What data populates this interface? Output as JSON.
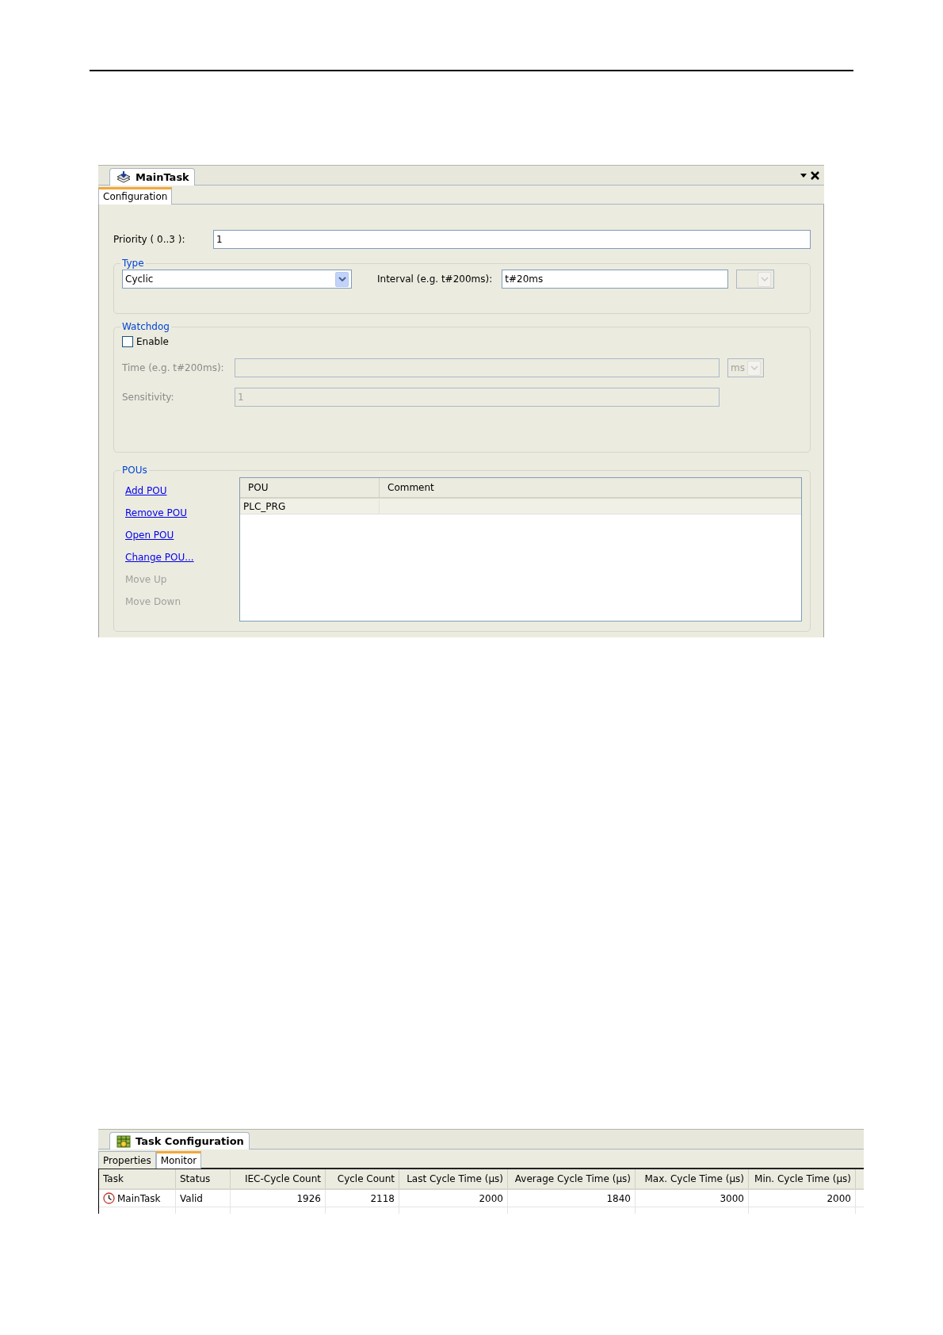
{
  "task_editor": {
    "title": "MainTask",
    "tabs": [
      {
        "label": "Configuration",
        "selected": true
      }
    ],
    "priority": {
      "label": "Priority (  0..3 ):",
      "value": "1"
    },
    "type_group": {
      "title": "Type",
      "type_value": "Cyclic",
      "interval_label": "Interval (e.g. t#200ms):",
      "interval_value": "t#20ms"
    },
    "watchdog": {
      "title": "Watchdog",
      "enable": {
        "label": "Enable",
        "checked": false
      },
      "disabled": true,
      "time_label": "Time (e.g. t#200ms):",
      "time_unit": "ms",
      "sensitivity_label": "Sensitivity:",
      "sensitivity_value": "1"
    },
    "pous": {
      "title": "POUs",
      "actions": [
        {
          "label": "Add POU",
          "disabled": false
        },
        {
          "label": "Remove POU",
          "disabled": false
        },
        {
          "label": "Open POU",
          "disabled": false
        },
        {
          "label": "Change POU...",
          "disabled": false
        },
        {
          "label": "Move Up",
          "disabled": true
        },
        {
          "label": "Move Down",
          "disabled": true
        }
      ],
      "columns": [
        "POU",
        "Comment"
      ],
      "rows": [
        {
          "pou": "PLC_PRG"
        }
      ]
    }
  },
  "task_monitor": {
    "title": "Task Configuration",
    "tabs": [
      {
        "label": "Properties",
        "selected": false
      },
      {
        "label": "Monitor",
        "selected": true
      }
    ],
    "columns": [
      "Task",
      "Status",
      "IEC-Cycle Count",
      "Cycle Count",
      "Last Cycle Time (µs)",
      "Average Cycle Time (µs)",
      "Max. Cycle Time (µs)",
      "Min. Cycle Time (µs)"
    ],
    "rows": [
      {
        "cells": [
          "MainTask",
          "Valid",
          "1926",
          "2118",
          "2000",
          "1840",
          "3000",
          "2000"
        ]
      }
    ]
  }
}
